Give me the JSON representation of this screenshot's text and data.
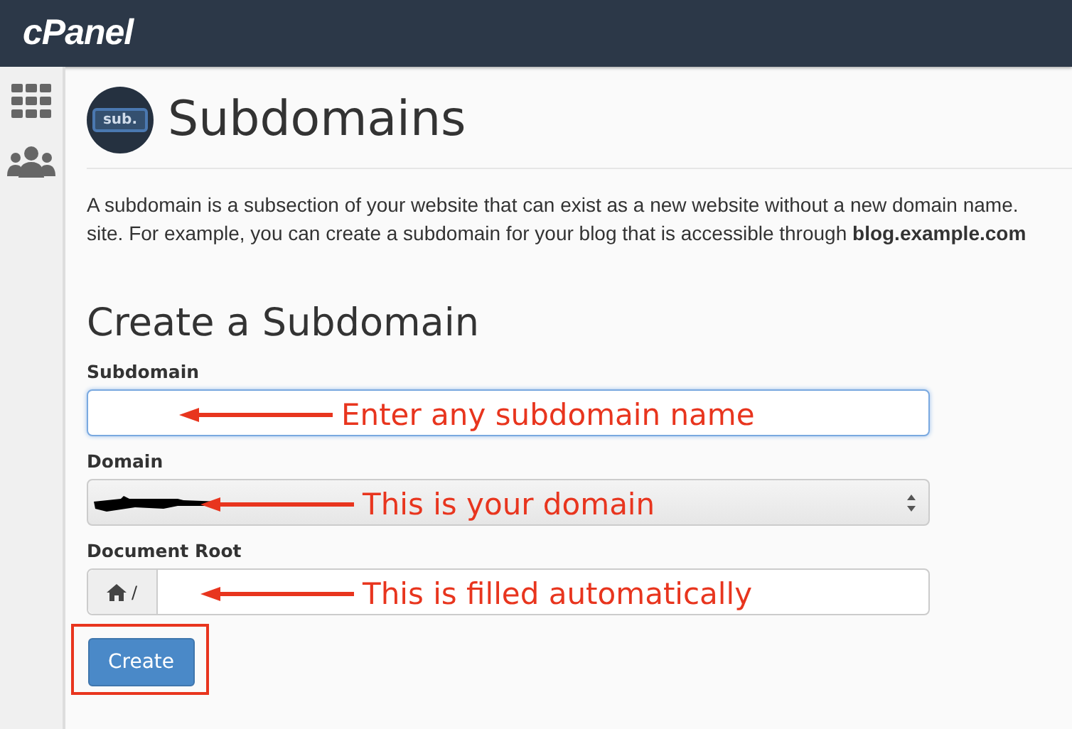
{
  "header": {
    "logo": "cPanel"
  },
  "page": {
    "icon_text": "sub.",
    "title": "Subdomains"
  },
  "description": {
    "lines": [
      "A subdomain is a subsection of your website that can exist as a new website without a new domain name.",
      "site. For example, you can create a subdomain for your blog that is accessible through **blog.example.com**"
    ]
  },
  "form": {
    "heading": "Create a Subdomain",
    "fields": [
      {
        "kind": "text",
        "label": "Subdomain",
        "focused": true,
        "annotation": "Enter any subdomain name"
      },
      {
        "kind": "select",
        "label": "Domain",
        "redacted": true,
        "annotation": "This is your domain"
      },
      {
        "kind": "path",
        "label": "Document Root",
        "prefix": "/",
        "annotation": "This is filled automatically"
      }
    ],
    "button": {
      "label": "Create",
      "highlighted": true
    }
  }
}
